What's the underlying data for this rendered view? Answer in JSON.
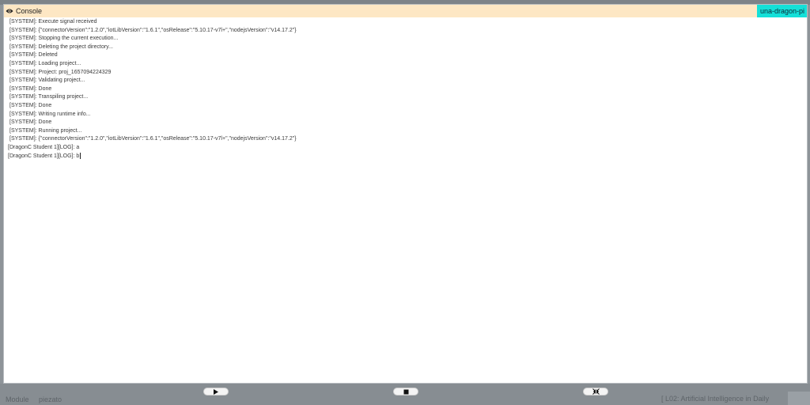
{
  "console": {
    "title": "Console",
    "device": "una-dragon-pi",
    "lines": [
      "[SYSTEM]: Execute signal received",
      "[SYSTEM]: {\"connectorVersion\":\"1.2.0\",\"iotLibVersion\":\"1.6.1\",\"osRelease\":\"5.10.17-v7l+\",\"nodejsVersion\":\"v14.17.2\"}",
      "[SYSTEM]: Stopping the current execution...",
      "[SYSTEM]: Deleting the project directory...",
      "[SYSTEM]: Deleted",
      "[SYSTEM]: Loading project...",
      "[SYSTEM]: Project: proj_1657094224329",
      "[SYSTEM]: Validating project...",
      "[SYSTEM]: Done",
      "[SYSTEM]: Transpiling project...",
      "[SYSTEM]: Done",
      "[SYSTEM]: Writing runtime info...",
      "[SYSTEM]: Done",
      "[SYSTEM]: Running project...",
      "[SYSTEM]: {\"connectorVersion\":\"1.2.0\",\"iotLibVersion\":\"1.6.1\",\"osRelease\":\"5.10.17-v7l+\",\"nodejsVersion\":\"v14.17.2\"}",
      "[DragonC Student 1][LOG]: a",
      "[DragonC Student 1][LOG]: b"
    ]
  },
  "controls": {
    "play": "play-icon",
    "stop": "stop-icon",
    "fullscreen": "collapse-icon"
  },
  "background": {
    "left_label": "Module",
    "left_value": "piezato",
    "right_label": "[ L02: Artificial Intelligence in Daily"
  },
  "colors": {
    "header_bg": "#fde7c4",
    "badge_bg": "#14e0d8"
  }
}
